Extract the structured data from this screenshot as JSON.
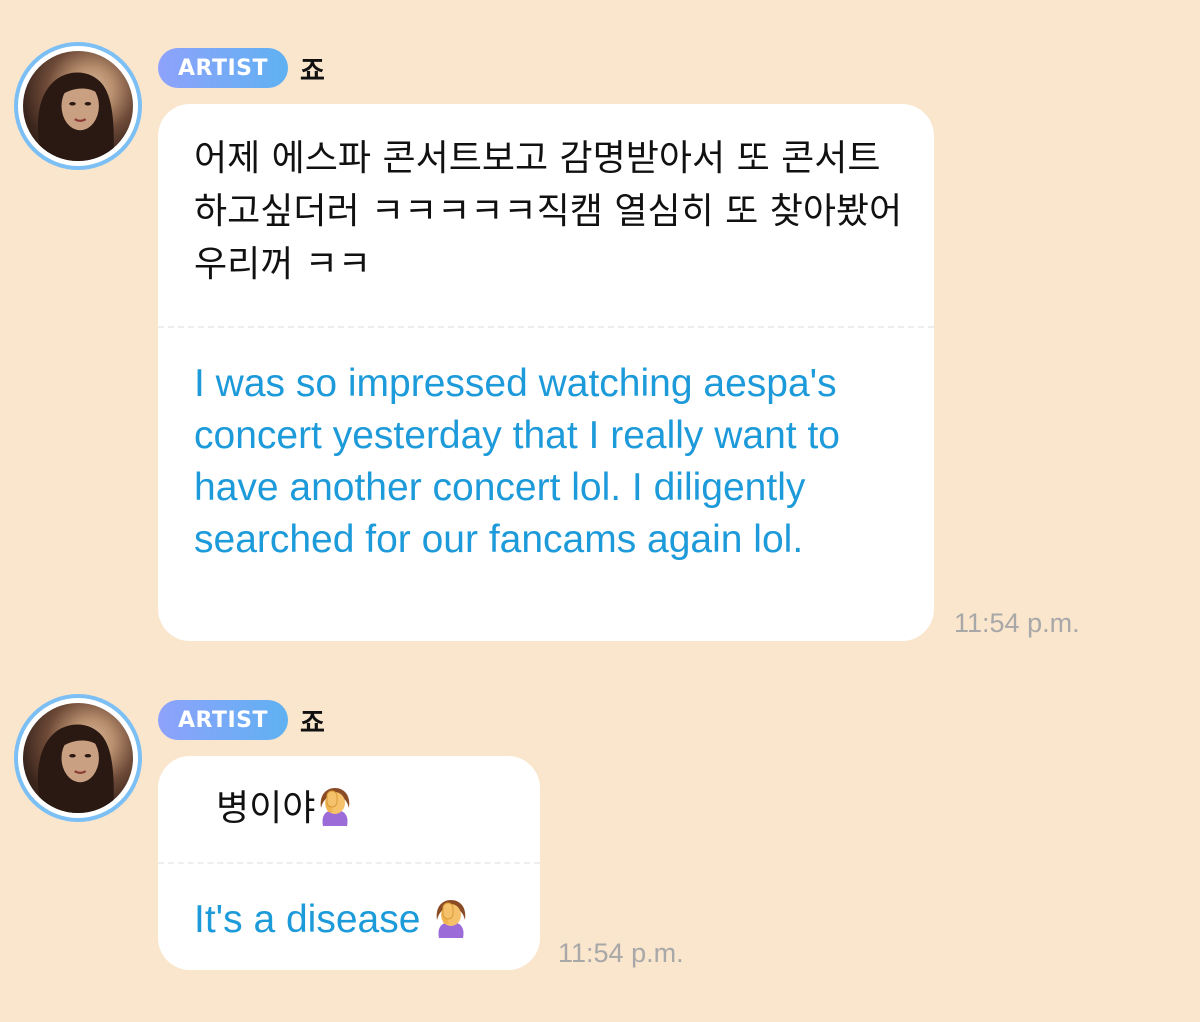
{
  "messages": [
    {
      "badge": "ARTIST",
      "sender": "죠",
      "korean": " 어제 에스파 콘서트보고 감명받아서 또 콘서트하고싶더러 ㅋㅋㅋㅋㅋ직캠 열심히 또 찾아봤어 우리꺼 ㅋㅋ",
      "english": "I was so impressed watching aespa's concert yesterday that I really want to have another concert lol. I diligently searched for our fancams again lol.",
      "time": "11:54 p.m."
    },
    {
      "badge": "ARTIST",
      "sender": "죠",
      "korean": "병이야",
      "english": "It's a disease ",
      "emoji": "facepalm-icon",
      "time": "11:54 p.m."
    }
  ],
  "colors": {
    "background": "#fae5cd",
    "badge_gradient_start": "#8ea2fb",
    "badge_gradient_end": "#5fb1f2",
    "translation_text": "#1d9ad9",
    "timestamp": "#a8a8a8",
    "avatar_ring": "#7cbff5"
  }
}
